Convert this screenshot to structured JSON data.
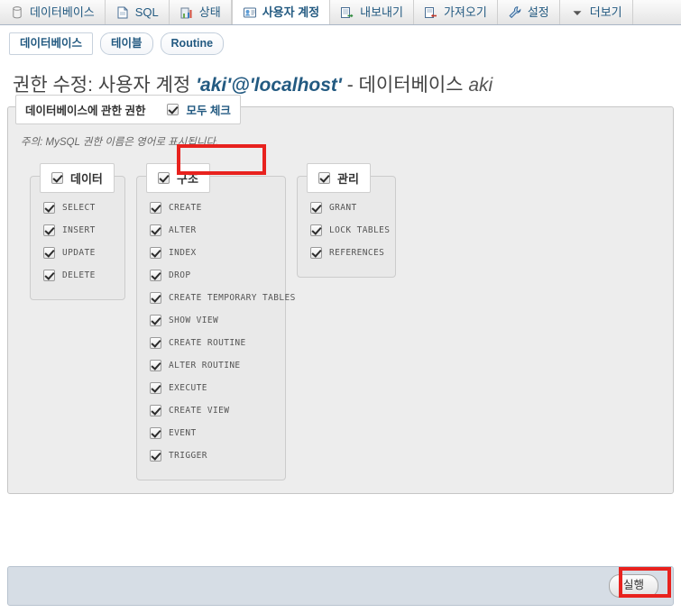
{
  "topnav": {
    "tabs": [
      {
        "label": "데이터베이스",
        "icon": "database-icon",
        "active": false
      },
      {
        "label": "SQL",
        "icon": "sql-icon",
        "active": false
      },
      {
        "label": "상태",
        "icon": "status-chart-icon",
        "active": false
      },
      {
        "label": "사용자 계정",
        "icon": "user-accounts-icon",
        "active": true
      },
      {
        "label": "내보내기",
        "icon": "export-icon",
        "active": false
      },
      {
        "label": "가져오기",
        "icon": "import-icon",
        "active": false
      },
      {
        "label": "설정",
        "icon": "wrench-settings-icon",
        "active": false
      },
      {
        "label": "더보기",
        "icon": "chevron-down-icon",
        "active": false
      }
    ]
  },
  "subnav": {
    "tabs": [
      {
        "label": "데이터베이스",
        "selected": true
      },
      {
        "label": "테이블",
        "selected": false
      },
      {
        "label": "Routine",
        "selected": false
      }
    ]
  },
  "title": {
    "prefix": "권한 수정: 사용자 계정 ",
    "account": "'aki'@'localhost'",
    "middle": " - 데이터베이스 ",
    "database": "aki"
  },
  "panel": {
    "legend": "데이터베이스에 관한 권한",
    "check_all_label": "모두 체크",
    "check_all_checked": true,
    "note": "주의: MySQL 권한 이름은 영어로 표시됩니다."
  },
  "columns": [
    {
      "legend": "데이터",
      "legend_checked": true,
      "privileges": [
        {
          "name": "SELECT",
          "checked": true
        },
        {
          "name": "INSERT",
          "checked": true
        },
        {
          "name": "UPDATE",
          "checked": true
        },
        {
          "name": "DELETE",
          "checked": true
        }
      ]
    },
    {
      "legend": "구조",
      "legend_checked": true,
      "privileges": [
        {
          "name": "CREATE",
          "checked": true
        },
        {
          "name": "ALTER",
          "checked": true
        },
        {
          "name": "INDEX",
          "checked": true
        },
        {
          "name": "DROP",
          "checked": true
        },
        {
          "name": "CREATE TEMPORARY TABLES",
          "checked": true
        },
        {
          "name": "SHOW VIEW",
          "checked": true
        },
        {
          "name": "CREATE ROUTINE",
          "checked": true
        },
        {
          "name": "ALTER ROUTINE",
          "checked": true
        },
        {
          "name": "EXECUTE",
          "checked": true
        },
        {
          "name": "CREATE VIEW",
          "checked": true
        },
        {
          "name": "EVENT",
          "checked": true
        },
        {
          "name": "TRIGGER",
          "checked": true
        }
      ]
    },
    {
      "legend": "관리",
      "legend_checked": true,
      "privileges": [
        {
          "name": "GRANT",
          "checked": true
        },
        {
          "name": "LOCK TABLES",
          "checked": true
        },
        {
          "name": "REFERENCES",
          "checked": true
        }
      ]
    }
  ],
  "footer": {
    "go_label": "실행"
  },
  "annotations": {
    "highlight_color": "#e8221e",
    "boxes": [
      {
        "target": "check-all-checkbox"
      },
      {
        "target": "go-button"
      }
    ]
  }
}
